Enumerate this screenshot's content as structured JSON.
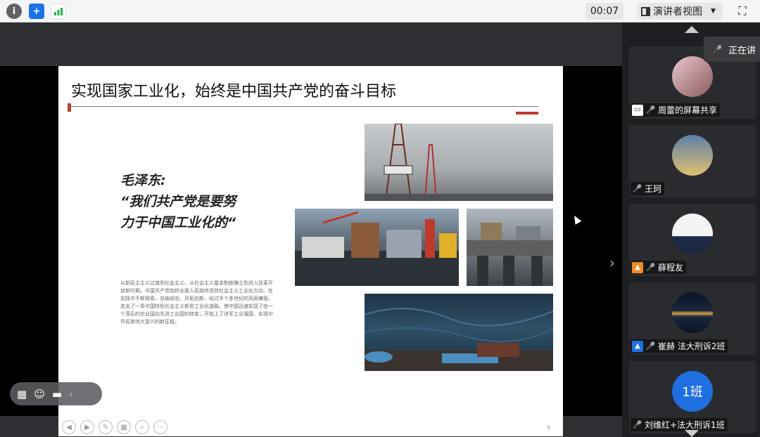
{
  "topbar": {
    "info_icon": "i",
    "shield_icon": "+",
    "timer": "00:07",
    "presenter_view_label": "演讲者视图"
  },
  "slide": {
    "title": "实现国家工业化，始终是中国共产党的奋斗目标",
    "quote_line1": "毛泽东:",
    "quote_line2": "“我们共产党是要努",
    "quote_line3": "力于中国工业化的“",
    "body": "从新民主主义过渡到社会主义、从社会主义基本制度确立到进入改革开放新时期，中国共产党始终全面人民始终坚持社会主义工业化方向、在实践中不断探索、总结经验，开拓创新，经过半个多世纪的风雨兼程，走出了一条中国特色社会主义新型工业化道路，使中国迅速实现了由一个落后的农业国向先进工业国的转变，开始上了进军工业强国、实现中华民族伟大复兴的新征程。",
    "page_number": "9"
  },
  "speaking_indicator": "正在讲",
  "participants": [
    {
      "name": "周蕾的屏幕共享",
      "role": "screen-share"
    },
    {
      "name": "王珂",
      "role": "member"
    },
    {
      "name": "薛程友",
      "role": "host"
    },
    {
      "name": "崔赫 法大刑诉2班",
      "role": "co-host"
    },
    {
      "name": "刘维红+法大刑诉1班",
      "role": "member",
      "avatar_text": "1班"
    }
  ],
  "colors": {
    "accent_red": "#c0392b",
    "mic_off": "#e04848",
    "host_orange": "#f08a24",
    "cohost_blue": "#1f6fe0"
  }
}
